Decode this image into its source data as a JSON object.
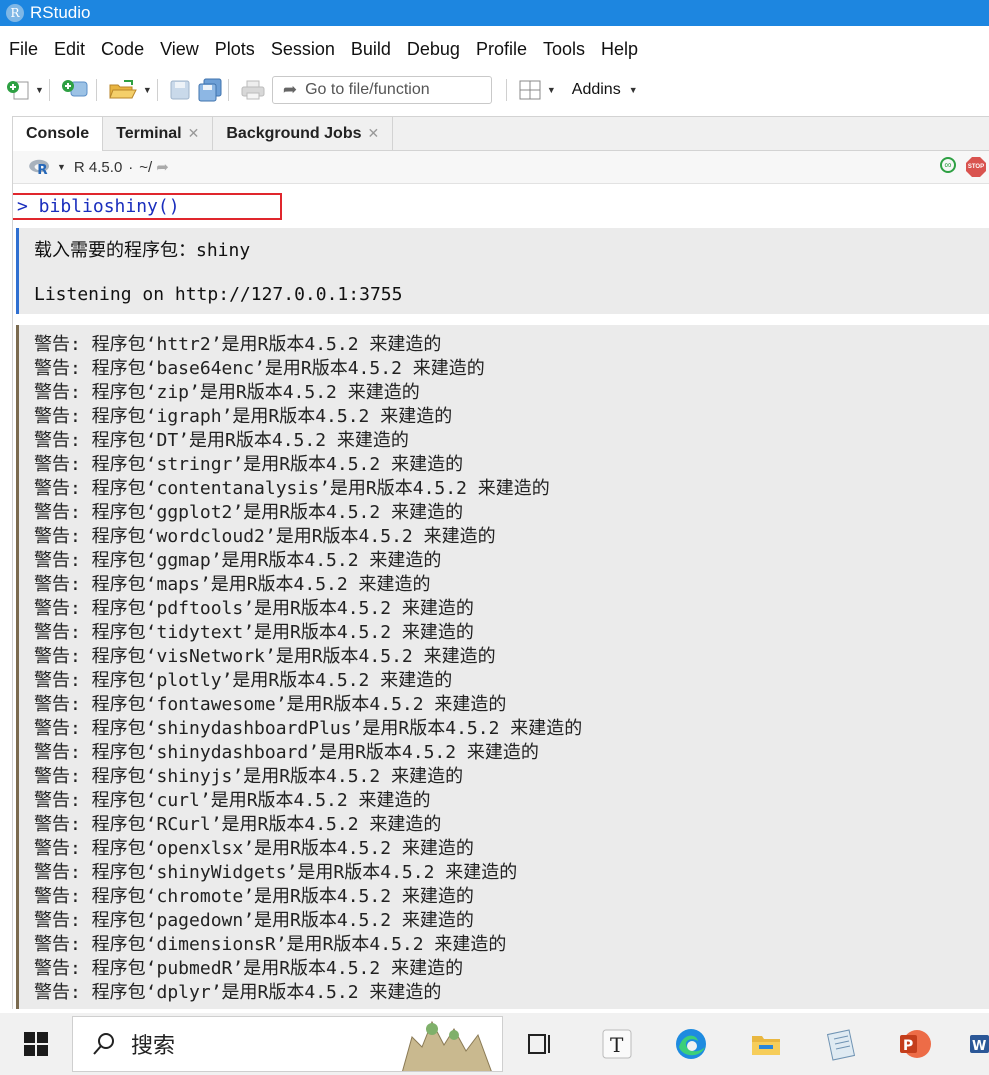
{
  "window": {
    "title": "RStudio",
    "app_icon_letter": "R"
  },
  "menu": [
    "File",
    "Edit",
    "Code",
    "View",
    "Plots",
    "Session",
    "Build",
    "Debug",
    "Profile",
    "Tools",
    "Help"
  ],
  "toolbar": {
    "goto_placeholder": "Go to file/function",
    "addins_label": "Addins"
  },
  "tabs": [
    {
      "label": "Console",
      "active": true,
      "closable": false
    },
    {
      "label": "Terminal",
      "active": false,
      "closable": true
    },
    {
      "label": "Background Jobs",
      "active": false,
      "closable": true
    }
  ],
  "console_header": {
    "r_version": "R 4.5.0",
    "separator": "·",
    "path": "~/"
  },
  "console": {
    "command": "> biblioshiny()",
    "messages": [
      "载入需要的程序包：shiny",
      "Listening on http://127.0.0.1:3755"
    ],
    "warnings": [
      "警告: 程序包‘httr2’是用R版本4.5.2 来建造的",
      "警告: 程序包‘base64enc’是用R版本4.5.2 来建造的",
      "警告: 程序包‘zip’是用R版本4.5.2 来建造的",
      "警告: 程序包‘igraph’是用R版本4.5.2 来建造的",
      "警告: 程序包‘DT’是用R版本4.5.2 来建造的",
      "警告: 程序包‘stringr’是用R版本4.5.2 来建造的",
      "警告: 程序包‘contentanalysis’是用R版本4.5.2 来建造的",
      "警告: 程序包‘ggplot2’是用R版本4.5.2 来建造的",
      "警告: 程序包‘wordcloud2’是用R版本4.5.2 来建造的",
      "警告: 程序包‘ggmap’是用R版本4.5.2 来建造的",
      "警告: 程序包‘maps’是用R版本4.5.2 来建造的",
      "警告: 程序包‘pdftools’是用R版本4.5.2 来建造的",
      "警告: 程序包‘tidytext’是用R版本4.5.2 来建造的",
      "警告: 程序包‘visNetwork’是用R版本4.5.2 来建造的",
      "警告: 程序包‘plotly’是用R版本4.5.2 来建造的",
      "警告: 程序包‘fontawesome’是用R版本4.5.2 来建造的",
      "警告: 程序包‘shinydashboardPlus’是用R版本4.5.2 来建造的",
      "警告: 程序包‘shinydashboard’是用R版本4.5.2 来建造的",
      "警告: 程序包‘shinyjs’是用R版本4.5.2 来建造的",
      "警告: 程序包‘curl’是用R版本4.5.2 来建造的",
      "警告: 程序包‘RCurl’是用R版本4.5.2 来建造的",
      "警告: 程序包‘openxlsx’是用R版本4.5.2 来建造的",
      "警告: 程序包‘shinyWidgets’是用R版本4.5.2 来建造的",
      "警告: 程序包‘chromote’是用R版本4.5.2 来建造的",
      "警告: 程序包‘pagedown’是用R版本4.5.2 来建造的",
      "警告: 程序包‘dimensionsR’是用R版本4.5.2 来建造的",
      "警告: 程序包‘pubmedR’是用R版本4.5.2 来建造的",
      "警告: 程序包‘dplyr’是用R版本4.5.2 来建造的"
    ]
  },
  "taskbar": {
    "search_label": "搜索",
    "text_app_letter": "T",
    "powerpoint_letter": "P",
    "word_letter": "W"
  },
  "colors": {
    "titlebar": "#1d86e0",
    "command_text": "#1a2ebd",
    "highlight_box": "#e0262d",
    "message_border": "#2f6fd1",
    "warning_border": "#7a6a4f"
  }
}
